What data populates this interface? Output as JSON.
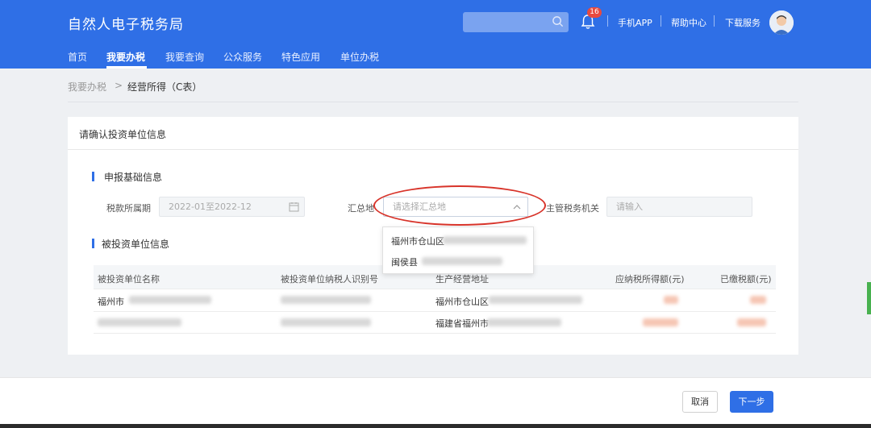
{
  "header": {
    "logo": "自然人电子税务局",
    "search_placeholder": "",
    "notification_count": "16",
    "links": [
      "手机APP",
      "帮助中心",
      "下载服务"
    ]
  },
  "nav": {
    "items": [
      "首页",
      "我要办税",
      "我要查询",
      "公众服务",
      "特色应用",
      "单位办税"
    ],
    "active": "我要办税"
  },
  "breadcrumb": {
    "parent": "我要办税",
    "separator": ">",
    "current": "经营所得（C表）"
  },
  "panel": {
    "title": "请确认投资单位信息",
    "basic_section": "申报基础信息",
    "period_label": "税款所属期",
    "period_value": "2022-01至2022-12",
    "summary_label": "汇总地",
    "summary_placeholder": "请选择汇总地",
    "tax_authority_label": "主管税务机关",
    "tax_authority_placeholder": "请输入",
    "invested_section": "被投资单位信息"
  },
  "dropdown": {
    "options": [
      "福州市仓山区",
      "闽侯县"
    ]
  },
  "table": {
    "headers": [
      "被投资单位名称",
      "被投资单位纳税人识别号",
      "生产经营地址",
      "应纳税所得额(元)",
      "已缴税额(元)"
    ],
    "rows": [
      {
        "name": "福州市",
        "address": "福州市仓山区"
      },
      {
        "name": "",
        "address": "福建省福州市"
      }
    ]
  },
  "footer": {
    "cancel": "取消",
    "next": "下一步"
  },
  "colors": {
    "primary": "#2f6fe6",
    "annotation": "#d8342a",
    "badge": "#e84a3f"
  }
}
